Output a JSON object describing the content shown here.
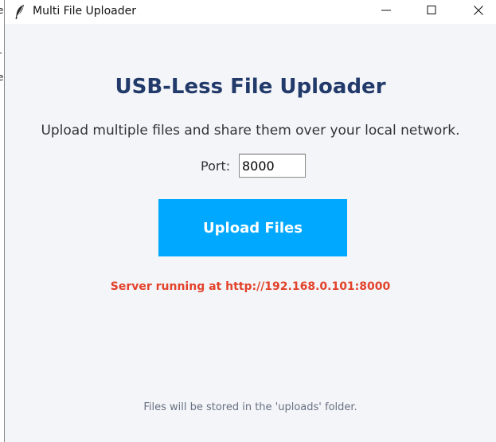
{
  "window": {
    "title": "Multi File Uploader",
    "icon": "feather-icon"
  },
  "main": {
    "heading": "USB-Less File Uploader",
    "subtitle": "Upload multiple files and share them over your local network.",
    "port_label": "Port:",
    "port_value": "8000",
    "upload_button_label": "Upload Files",
    "status_text": "Server running at http://192.168.0.101:8000",
    "footer_note": "Files will be stored in the 'uploads' folder."
  },
  "colors": {
    "button_bg": "#00a8ff",
    "heading": "#223a6a",
    "status": "#e2432a",
    "window_bg": "#f4f5f9"
  }
}
